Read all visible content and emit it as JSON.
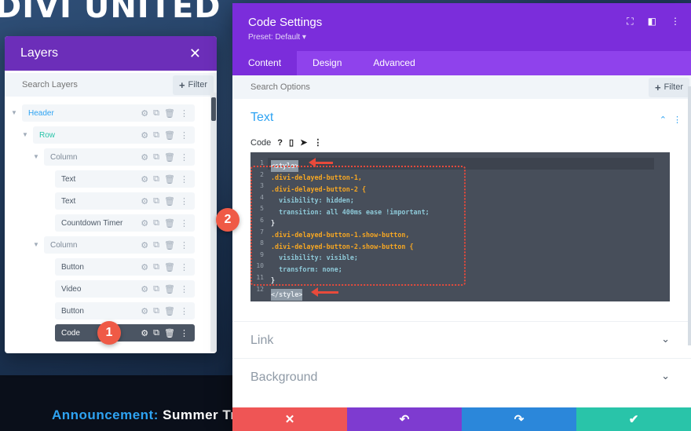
{
  "background": {
    "title": "DIVI UNITED",
    "announcement_label": "Announcement:",
    "announcement_text": "Summer Tr"
  },
  "layers_panel": {
    "title": "Layers",
    "close_icon": "close-icon",
    "search_placeholder": "Search Layers",
    "filter_label": "Filter",
    "items": [
      {
        "label": "Header",
        "type": "section"
      },
      {
        "label": "Row",
        "type": "row"
      },
      {
        "label": "Column",
        "type": "column"
      },
      {
        "label": "Text",
        "type": "module"
      },
      {
        "label": "Text",
        "type": "module"
      },
      {
        "label": "Countdown Timer",
        "type": "module"
      },
      {
        "label": "Column",
        "type": "column"
      },
      {
        "label": "Button",
        "type": "module"
      },
      {
        "label": "Video",
        "type": "module"
      },
      {
        "label": "Button",
        "type": "module"
      },
      {
        "label": "Code",
        "type": "module",
        "selected": true
      }
    ]
  },
  "modal": {
    "title": "Code Settings",
    "preset": "Preset: Default ▾",
    "tabs": [
      "Content",
      "Design",
      "Advanced"
    ],
    "active_tab": "Content",
    "search_placeholder": "Search Options",
    "filter_label": "Filter",
    "section_text": "Text",
    "code_label": "Code",
    "code_lines": [
      "<style>",
      ".divi-delayed-button-1,",
      ".divi-delayed-button-2 {",
      "  visibility: hidden;",
      "  transition: all 400ms ease !important;",
      "}",
      ".divi-delayed-button-1.show-button,",
      ".divi-delayed-button-2.show-button {",
      "  visibility: visible;",
      "  transform: none;",
      "}",
      "</style>"
    ],
    "line_numbers": [
      "1",
      "2",
      "3",
      "4",
      "5",
      "6",
      "7",
      "8",
      "9",
      "10",
      "11",
      "12"
    ],
    "collapsed_sections": [
      "Link",
      "Background"
    ]
  },
  "footer": {
    "cancel_icon": "close-icon",
    "undo_icon": "undo-icon",
    "redo_icon": "redo-icon",
    "save_icon": "check-icon"
  },
  "annotations": {
    "badge_1": "1",
    "badge_2": "2"
  },
  "colors": {
    "purple": "#7b2ddb",
    "tab_bar": "#8f42ec",
    "divi_blue": "#2ea3f2",
    "teal": "#29c4a9",
    "red": "#ef5555",
    "annotation": "#e84a3b"
  }
}
